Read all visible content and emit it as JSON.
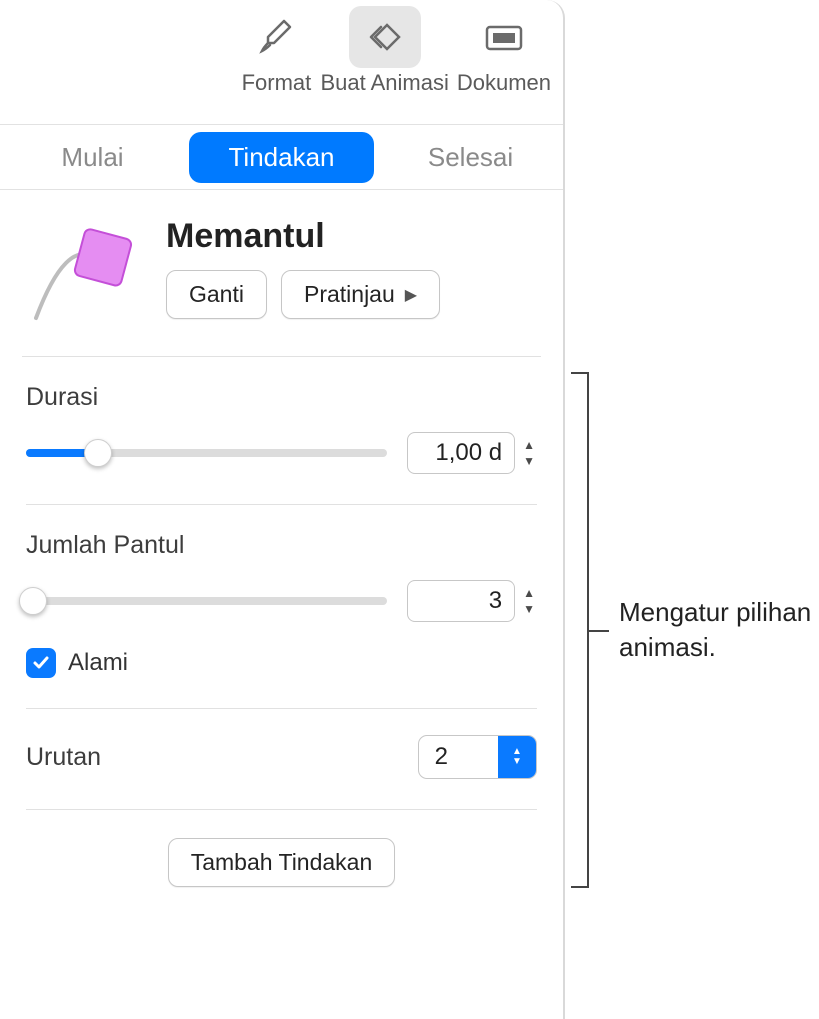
{
  "toolbar": {
    "format": "Format",
    "animate": "Buat Animasi",
    "document": "Dokumen"
  },
  "tabs": {
    "start": "Mulai",
    "action": "Tindakan",
    "finish": "Selesai"
  },
  "effect": {
    "name": "Memantul",
    "change_label": "Ganti",
    "preview_label": "Pratinjau"
  },
  "duration": {
    "label": "Durasi",
    "value": "1,00 d",
    "slider_percent": 20
  },
  "bounces": {
    "label": "Jumlah Pantul",
    "value": "3",
    "slider_percent": 2,
    "natural_label": "Alami",
    "natural_checked": true
  },
  "order": {
    "label": "Urutan",
    "value": "2"
  },
  "footer": {
    "add_action": "Tambah Tindakan"
  },
  "callout": "Mengatur pilihan animasi."
}
